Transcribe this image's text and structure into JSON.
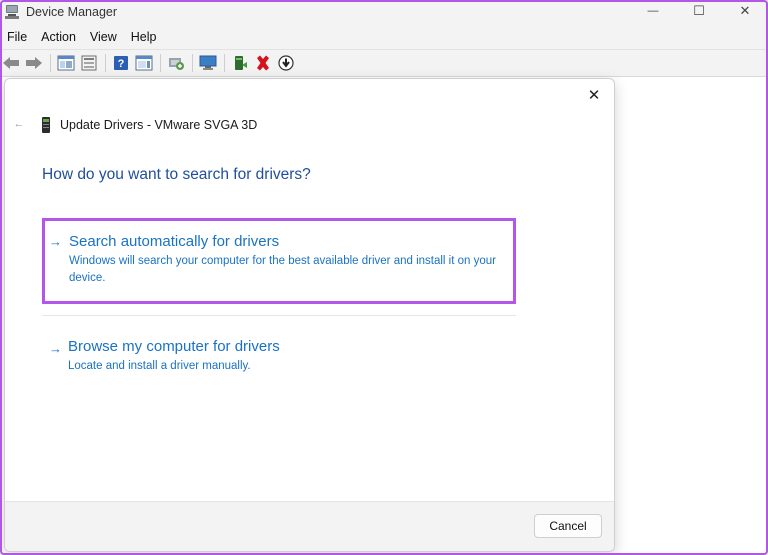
{
  "window": {
    "title": "Device Manager",
    "minimize_glyph": "—",
    "maximize_glyph": "☐",
    "close_glyph": "✕"
  },
  "menu": [
    "File",
    "Action",
    "View",
    "Help"
  ],
  "toolbar": {
    "icons": [
      "back-arrow-icon",
      "forward-arrow-icon",
      "show-hide-tree-icon",
      "properties-icon",
      "help-icon",
      "action-pane-icon",
      "scan-hardware-icon",
      "monitor-icon",
      "update-driver-icon",
      "uninstall-device-icon",
      "disable-device-icon"
    ]
  },
  "dialog": {
    "header": "Update Drivers - VMware SVGA 3D",
    "question": "How do you want to search for drivers?",
    "option1": {
      "title": "Search automatically for drivers",
      "description": "Windows will search your computer for the best available driver and install it on your device.",
      "arrow": "→"
    },
    "option2": {
      "title": "Browse my computer for drivers",
      "description": "Locate and install a driver manually.",
      "arrow": "→"
    },
    "cancel_label": "Cancel",
    "close_glyph": "✕",
    "back_glyph": "←"
  },
  "colors": {
    "highlight": "#b356e9",
    "link": "#1a72c5",
    "question": "#1f4e9c"
  }
}
